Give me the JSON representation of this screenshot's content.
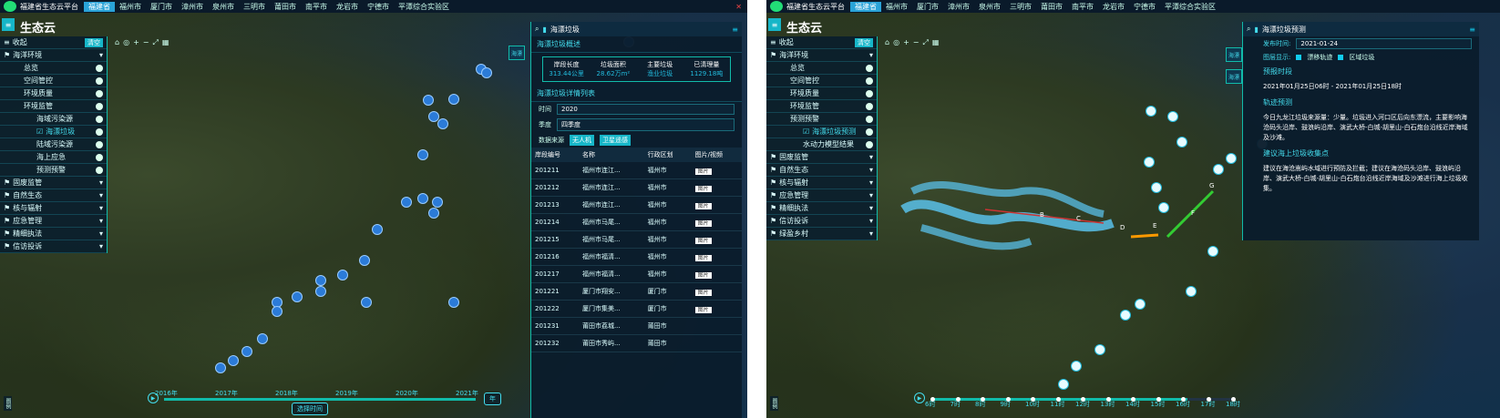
{
  "app_title": "福建省生态云平台",
  "brand": "生态云",
  "tabs": [
    "福建省",
    "福州市",
    "厦门市",
    "漳州市",
    "泉州市",
    "三明市",
    "莆田市",
    "南平市",
    "龙岩市",
    "宁德市",
    "平潭综合实验区"
  ],
  "left_panel": {
    "collapse_label": "收起",
    "clear_label": "清空",
    "items": [
      {
        "label": "海洋环境",
        "level": 0,
        "expanded": true
      },
      {
        "label": "总览",
        "level": 1
      },
      {
        "label": "空间管控",
        "level": 1
      },
      {
        "label": "环境质量",
        "level": 1
      },
      {
        "label": "环境监管",
        "level": 1
      },
      {
        "label": "海域污染源",
        "level": 2
      },
      {
        "label": "海漂垃圾",
        "level": 2,
        "selected": true
      },
      {
        "label": "陆域污染源",
        "level": 2
      },
      {
        "label": "海上应急",
        "level": 2
      },
      {
        "label": "预测预警",
        "level": 2
      },
      {
        "label": "固废监管",
        "level": 0
      },
      {
        "label": "自然生态",
        "level": 0
      },
      {
        "label": "核与辐射",
        "level": 0
      },
      {
        "label": "应急管理",
        "level": 0
      },
      {
        "label": "精细执法",
        "level": 0
      },
      {
        "label": "信访投诉",
        "level": 0
      }
    ]
  },
  "right_panel_1": {
    "title": "海漂垃圾",
    "side_tab": "海漂",
    "overview_title": "海漂垃圾概述",
    "summary": [
      {
        "k": "岸段长度",
        "v": "313.44公里"
      },
      {
        "k": "垃圾面积",
        "v": "28.62万m²"
      },
      {
        "k": "主要垃圾",
        "v": "渔业垃圾"
      },
      {
        "k": "已清理量",
        "v": "1129.18吨"
      }
    ],
    "detail_title": "海漂垃圾详情列表",
    "time_label": "时间",
    "time_value": "2020",
    "season_label": "季度",
    "season_value": "四季度",
    "source_label": "数据来源",
    "source_opts": [
      "无人机",
      "卫星遥感"
    ],
    "columns": [
      "岸段编号",
      "名称",
      "行政区划",
      "图片/视频"
    ],
    "rows": [
      [
        "201211",
        "福州市连江...",
        "福州市",
        "图片"
      ],
      [
        "201212",
        "福州市连江...",
        "福州市",
        "图片"
      ],
      [
        "201213",
        "福州市连江...",
        "福州市",
        "图片"
      ],
      [
        "201214",
        "福州市马尾...",
        "福州市",
        "图片"
      ],
      [
        "201215",
        "福州市马尾...",
        "福州市",
        "图片"
      ],
      [
        "201216",
        "福州市福清...",
        "福州市",
        "图片"
      ],
      [
        "201217",
        "福州市福清...",
        "福州市",
        "图片"
      ],
      [
        "201221",
        "厦门市翔安...",
        "厦门市",
        "图片"
      ],
      [
        "201222",
        "厦门市集美...",
        "厦门市",
        "图片"
      ],
      [
        "201231",
        "莆田市荔城...",
        "莆田市",
        ""
      ],
      [
        "201232",
        "莆田市秀屿...",
        "莆田市",
        ""
      ]
    ]
  },
  "timeline_1": {
    "years": [
      "2016年",
      "2017年",
      "2018年",
      "2019年",
      "2020年",
      "2021年"
    ],
    "unit": "年",
    "select_label": "选择时间"
  },
  "left_panel_2": {
    "items": [
      {
        "label": "海洋环境",
        "level": 0
      },
      {
        "label": "总览",
        "level": 1
      },
      {
        "label": "空间管控",
        "level": 1
      },
      {
        "label": "环境质量",
        "level": 1
      },
      {
        "label": "环境监管",
        "level": 1
      },
      {
        "label": "预测预警",
        "level": 1
      },
      {
        "label": "海漂垃圾预测",
        "level": 2,
        "selected": true
      },
      {
        "label": "水动力模型结果",
        "level": 2
      },
      {
        "label": "固废监管",
        "level": 0
      },
      {
        "label": "自然生态",
        "level": 0
      },
      {
        "label": "核与辐射",
        "level": 0
      },
      {
        "label": "应急管理",
        "level": 0
      },
      {
        "label": "精细执法",
        "level": 0
      },
      {
        "label": "信访投诉",
        "level": 0
      },
      {
        "label": "绿盈乡村",
        "level": 0
      }
    ]
  },
  "right_panel_2": {
    "title": "海漂垃圾预测",
    "side_tabs": [
      "海漂",
      "海漂"
    ],
    "publish_label": "发布时间:",
    "publish_value": "2021-01-24",
    "legend_label": "图层显示:",
    "legend_opts": [
      "漂移轨迹",
      "区域垃圾"
    ],
    "forecast_time_title": "预报时段",
    "forecast_time": "2021年01月25日06时 - 2021年01月25日18时",
    "track_title": "轨迹预测",
    "track_text": "今日九龙江垃圾来源量：少量。垃圾进入河口区后向东漂流，主要影响海沧码头沿岸、鼓浪屿沿岸、演武大桥-白城-胡里山-白石炮台沿线近岸海域及沙滩。",
    "advice_title": "建议海上垃圾收集点",
    "advice_text": "建议在海沧嵩屿水域进行预防及拦截；建议在海沧码头沿岸、鼓浪屿沿岸、演武大桥-白城-胡里山-白石炮台沿线近岸海域及沙滩进行海上垃圾收集。"
  },
  "timeline_2": {
    "hours": [
      "6时",
      "7时",
      "8时",
      "9时",
      "10时",
      "11时",
      "12时",
      "13时",
      "14时",
      "15时",
      "16时",
      "17时",
      "18时"
    ]
  },
  "point_labels": [
    "B",
    "C",
    "D",
    "E",
    "F",
    "G"
  ],
  "legend_tag": "图例"
}
